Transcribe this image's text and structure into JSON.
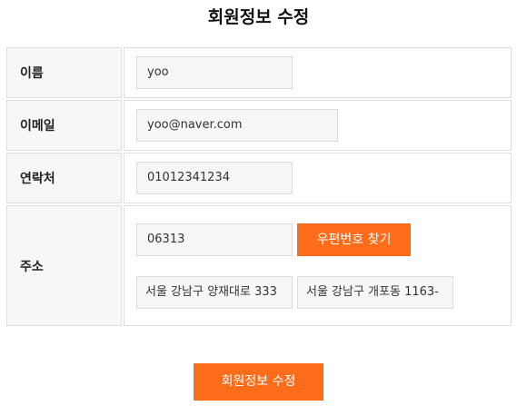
{
  "page": {
    "title": "회원정보 수정"
  },
  "form": {
    "name": {
      "label": "이름",
      "value": "yoo"
    },
    "email": {
      "label": "이메일",
      "value": "yoo@naver.com"
    },
    "phone": {
      "label": "연락처",
      "value": "01012341234"
    },
    "address": {
      "label": "주소",
      "zipcode": "06313",
      "zip_button_label": "우편번호 찾기",
      "road_address": "서울 강남구 양재대로 333",
      "jibun_address": "서울 강남구 개포동 1163-"
    }
  },
  "actions": {
    "submit_label": "회원정보 수정"
  },
  "colors": {
    "accent": "#ff6d1a",
    "label_bg": "#f7f7f7",
    "field_bg": "#f6f6f6",
    "border": "#dedede"
  }
}
